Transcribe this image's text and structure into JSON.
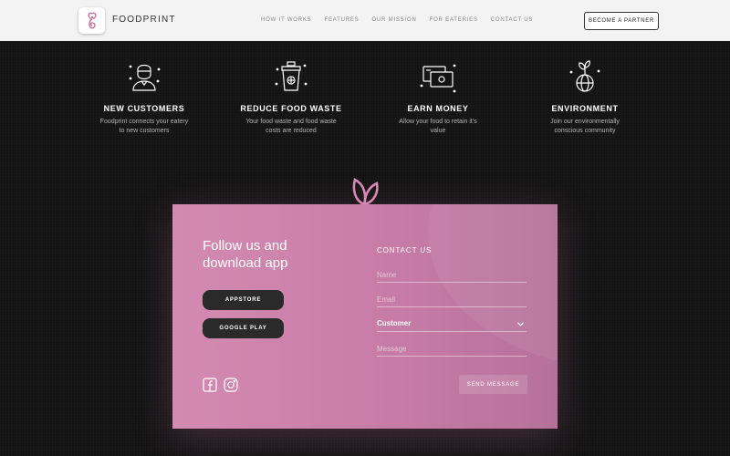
{
  "header": {
    "brand": "FOODPRINT",
    "nav": [
      "HOW IT WORKS",
      "FEATURES",
      "OUR MISSION",
      "FOR EATERIES",
      "CONTACT US"
    ],
    "cta": "BECOME A PARTNER"
  },
  "features": [
    {
      "icon": "customer-icon",
      "title": "NEW CUSTOMERS",
      "desc": "Foodprint connects your eatery to new customers"
    },
    {
      "icon": "food-bin-icon",
      "title": "REDUCE FOOD WASTE",
      "desc": "Your food waste and food waste costs are reduced"
    },
    {
      "icon": "money-cards-icon",
      "title": "EARN MONEY",
      "desc": "Allow your food to retain it's value"
    },
    {
      "icon": "globe-sprout-icon",
      "title": "ENVIRONMENT",
      "desc": "Join our environmentally conscious community"
    }
  ],
  "card": {
    "follow_title": "Follow us and download app",
    "appstore": "APPSTORE",
    "google_play": "GOOGLE PLAY",
    "contact_title": "CONTACT US",
    "name_placeholder": "Name",
    "email_placeholder": "Email",
    "select_value": "Customer",
    "message_placeholder": "Message",
    "send": "SEND MESSAGE"
  },
  "colors": {
    "card_pink": "#cc84ac",
    "leaf_pink": "#d98bb4",
    "dark_bg": "#141414"
  }
}
